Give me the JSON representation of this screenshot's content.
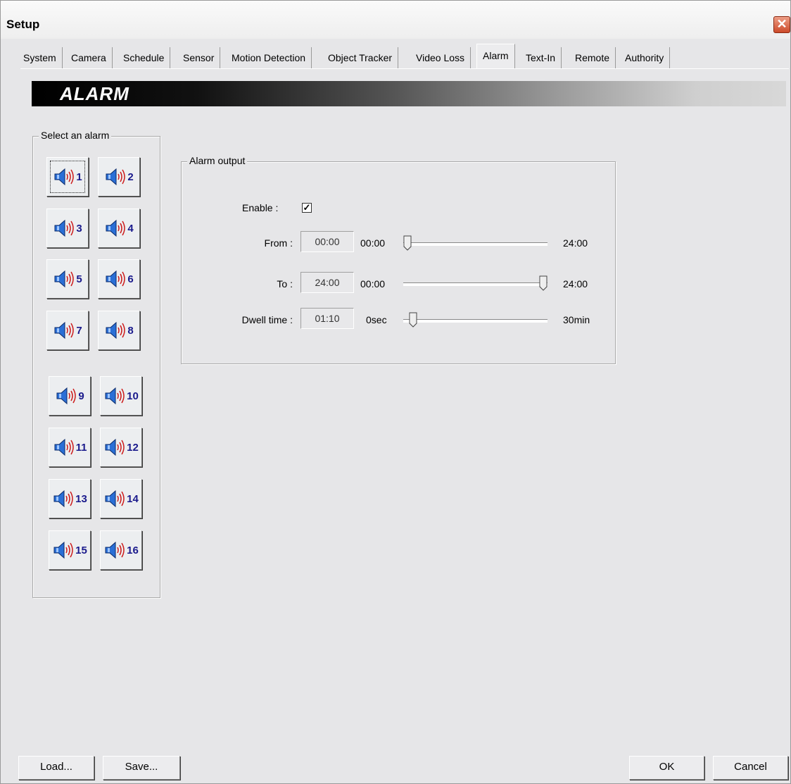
{
  "window": {
    "title": "Setup"
  },
  "tabs": [
    "System",
    "Camera",
    "Schedule",
    "Sensor",
    "Motion Detection",
    "Object Tracker",
    "Video Loss",
    "Alarm",
    "Text-In",
    "Remote",
    "Authority"
  ],
  "active_tab": "Alarm",
  "banner": {
    "title": "ALARM"
  },
  "alarm_select": {
    "group_label": "Select an alarm",
    "selected": "1",
    "alarms": [
      "1",
      "2",
      "3",
      "4",
      "5",
      "6",
      "7",
      "8",
      "9",
      "10",
      "11",
      "12",
      "13",
      "14",
      "15",
      "16"
    ]
  },
  "alarm_output": {
    "group_label": "Alarm output",
    "enable_label": "Enable :",
    "enable_checked": true,
    "from": {
      "label": "From :",
      "value": "00:00",
      "min": "00:00",
      "max": "24:00",
      "position": 0.0
    },
    "to": {
      "label": "To :",
      "value": "24:00",
      "min": "00:00",
      "max": "24:00",
      "position": 1.0
    },
    "dwell": {
      "label": "Dwell time :",
      "value": "01:10",
      "min": "0sec",
      "max": "30min",
      "position": 0.04
    }
  },
  "buttons": {
    "load": "Load...",
    "save": "Save...",
    "ok": "OK",
    "cancel": "Cancel"
  },
  "colors": {
    "alarm_number": "#1a1a8c",
    "speaker_wave": "#cc1a1a",
    "speaker_body": "#2a6fd6"
  }
}
